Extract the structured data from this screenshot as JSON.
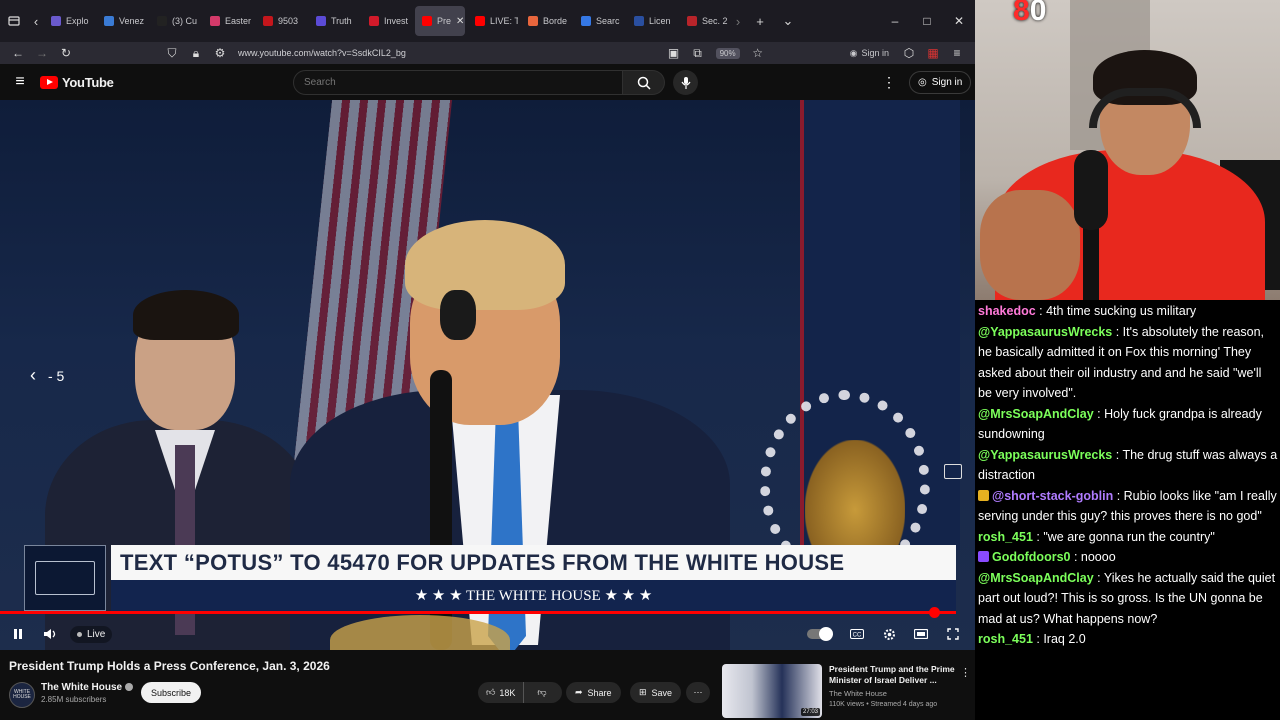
{
  "browser": {
    "tabs": [
      {
        "label": "Explo",
        "color": "#6a5acd",
        "active": false
      },
      {
        "label": "Venez",
        "color": "#3a7bd5",
        "active": false
      },
      {
        "label": "(3) Cu",
        "color": "#222222",
        "active": false
      },
      {
        "label": "Easter",
        "color": "#d33a6a",
        "active": false
      },
      {
        "label": "9503",
        "color": "#c4161c",
        "active": false
      },
      {
        "label": "Truth",
        "color": "#5b4bd6",
        "active": false
      },
      {
        "label": "Invest",
        "color": "#d11a2a",
        "active": false
      },
      {
        "label": "Pre",
        "color": "#ff0000",
        "active": true
      },
      {
        "label": "LIVE: T",
        "color": "#ff0000",
        "active": false
      },
      {
        "label": "Borde",
        "color": "#e8663d",
        "active": false
      },
      {
        "label": "Searc",
        "color": "#3578e5",
        "active": false
      },
      {
        "label": "Licen",
        "color": "#2a4fa0",
        "active": false
      },
      {
        "label": "Sec. 2",
        "color": "#b8242a",
        "active": false
      }
    ],
    "url": "www.youtube.com/watch?v=SsdkCIL2_bg",
    "zoom": "90%",
    "signin_label": "Sign in"
  },
  "youtube": {
    "logo_text": "YouTube",
    "search_placeholder": "Search",
    "signin_label": "Sign in"
  },
  "video": {
    "seek_back_label": "- 5",
    "lower_third_main": "TEXT “POTUS” TO 45470 FOR UPDATES FROM THE WHITE HOUSE",
    "lower_third_sub": "★ ★ ★   THE WHITE HOUSE   ★ ★ ★",
    "live_label": "Live",
    "progress_fraction": 0.98
  },
  "info": {
    "title": "President Trump Holds a Press Conference, Jan. 3, 2026",
    "channel": "The White House",
    "subscribers": "2.85M subscribers",
    "subscribe_label": "Subscribe",
    "likes": "18K",
    "share_label": "Share",
    "save_label": "Save",
    "avatar_text": "WHITE HOUSE"
  },
  "recommended": {
    "title": "President Trump and the Prime Minister of Israel Deliver ...",
    "channel": "The White House",
    "meta": "110K views • Streamed 4 days ago",
    "duration": "27:03"
  },
  "webcam": {
    "counter": "0",
    "counter_prefix": "8"
  },
  "chat": [
    {
      "user": "shakedoc",
      "color": "#ff7ad9",
      "text": "4th time sucking us military",
      "badge": ""
    },
    {
      "user": "@YappasaurusWrecks",
      "color": "#7cff5b",
      "text": "It's absolutely the reason, he basically admitted it on Fox this morning' They asked about their oil industry and and he said \"we'll be very involved\".",
      "badge": ""
    },
    {
      "user": "@MrsSoapAndClay",
      "color": "#7cff5b",
      "text": "Holy fuck grandpa is already sundowning",
      "badge": ""
    },
    {
      "user": "@YappasaurusWrecks",
      "color": "#7cff5b",
      "text": "The drug stuff was always a distraction",
      "badge": ""
    },
    {
      "user": "@short-stack-goblin",
      "color": "#b07cff",
      "text": "Rubio looks like \"am I really serving under this guy? this proves there is no god\"",
      "badge": "#e6b020"
    },
    {
      "user": "rosh_451",
      "color": "#7cff5b",
      "text": "\"we are gonna run the country\"",
      "badge": ""
    },
    {
      "user": "Godofdoors0",
      "color": "#7cff5b",
      "text": "noooo",
      "badge": "#8a4bff"
    },
    {
      "user": "@MrsSoapAndClay",
      "color": "#7cff5b",
      "text": "Yikes he actually said the quiet part out loud?! This is so gross. Is the UN gonna be mad at us? What happens now?",
      "badge": ""
    },
    {
      "user": "rosh_451",
      "color": "#7cff5b",
      "text": "Iraq 2.0",
      "badge": ""
    }
  ]
}
